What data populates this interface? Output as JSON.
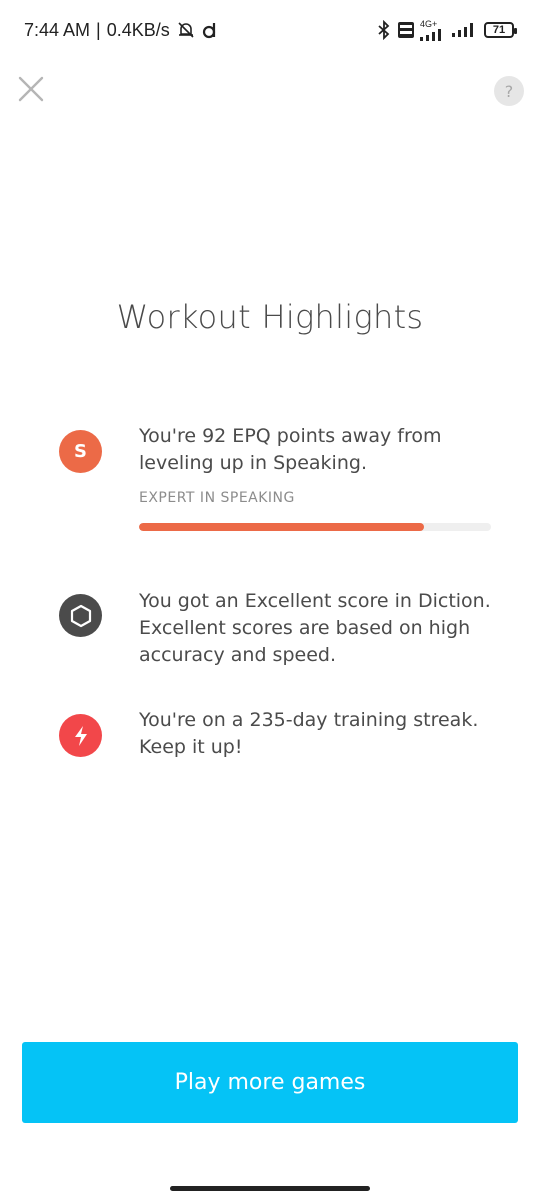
{
  "status_bar": {
    "time": "7:44 AM",
    "separator": "|",
    "network_speed": "0.4KB/s",
    "network_type": "4G+",
    "battery": "71"
  },
  "header": {
    "close_icon": "close-icon",
    "help_label": "?"
  },
  "title": "Workout Highlights",
  "highlights": [
    {
      "icon": "speaking-badge-icon",
      "icon_letter": "S",
      "icon_color": "#ec6a47",
      "text": "You're 92 EPQ points away from leveling up in Speaking.",
      "caption": "EXPERT IN SPEAKING",
      "progress_percent": 81
    },
    {
      "icon": "hexagon-icon",
      "icon_color": "#4b4b4b",
      "text": "You got an Excellent score in Diction. Excellent scores are based on high accuracy and speed."
    },
    {
      "icon": "lightning-icon",
      "icon_color": "#f2474a",
      "text": "You're on a 235-day training streak. Keep it up!"
    }
  ],
  "footer": {
    "button_label": "Play more games",
    "button_color": "#05c3f6"
  }
}
